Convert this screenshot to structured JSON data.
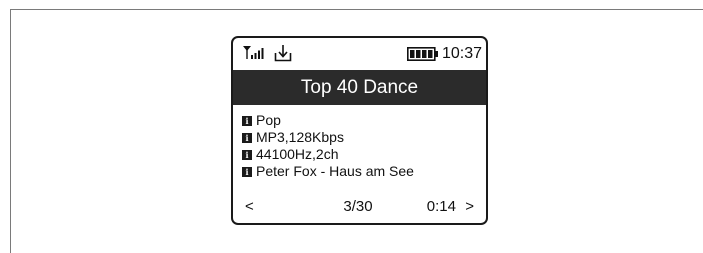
{
  "status_bar": {
    "signal_icon": "signal-strength-icon",
    "download_icon": "download-icon",
    "battery_icon": "battery-full-icon",
    "time": "10:37"
  },
  "station": {
    "title": "Top 40 Dance"
  },
  "info": [
    {
      "icon": "info-icon",
      "text": "Pop"
    },
    {
      "icon": "info-icon",
      "text": "MP3,128Kbps"
    },
    {
      "icon": "info-icon",
      "text": "44100Hz,2ch"
    },
    {
      "icon": "info-icon",
      "text": "Peter Fox - Haus am See"
    }
  ],
  "footer": {
    "prev": "<",
    "track": "3/30",
    "elapsed": "0:14",
    "next": ">"
  }
}
